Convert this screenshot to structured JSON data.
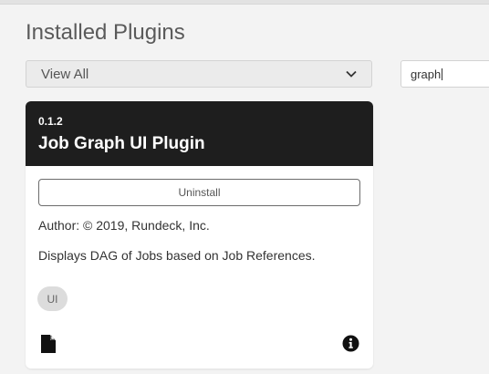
{
  "page": {
    "title": "Installed Plugins"
  },
  "filter": {
    "selected": "View All"
  },
  "search": {
    "value": "graph"
  },
  "plugin": {
    "version": "0.1.2",
    "title": "Job Graph UI Plugin",
    "uninstall_label": "Uninstall",
    "author": "Author: © 2019, Rundeck, Inc.",
    "description": "Displays DAG of Jobs based on Job References.",
    "tag": "UI",
    "icons": {
      "file": "file-icon",
      "info": "info-icon"
    }
  },
  "colors": {
    "card_header_bg": "#1e1e1e",
    "page_bg": "#f3f3f3"
  }
}
